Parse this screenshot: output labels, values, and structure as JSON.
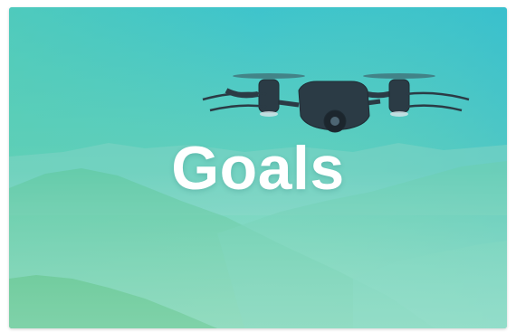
{
  "hero": {
    "title": "Goals",
    "image_icon": "drone-over-mountains",
    "colors": {
      "sky_top": "#43c5c9",
      "sky_bottom": "#6fd3a8",
      "mountain_near": "#52c38b",
      "mountain_far": "#7ecfba",
      "title_text": "#ffffff",
      "drone_body": "#2a3a45"
    }
  }
}
